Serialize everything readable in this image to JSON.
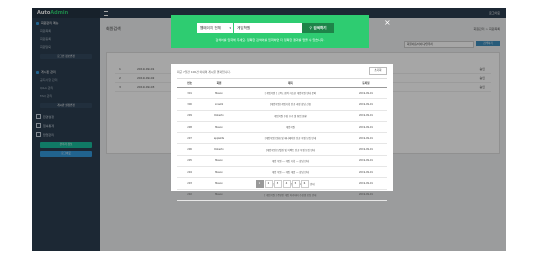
{
  "app": {
    "brand_main": "Auto",
    "brand_accent": "Admin",
    "logout": "로그아웃"
  },
  "sidebar": {
    "group1": {
      "title": "회원관리 메뉴",
      "items": [
        "회원목록",
        "회원등록",
        "회원탈퇴"
      ],
      "button": "로그인 정보변경"
    },
    "group2": {
      "title": "게시판 관리",
      "items": [
        "공지사항 관리",
        "Q&A 관리",
        "FAQ 관리"
      ],
      "button": "게시판 설정변경"
    },
    "links": [
      "환경설정",
      "접속통계",
      "팝업관리"
    ],
    "btn_green": "관리자 정보",
    "btn_blue": "로그아웃"
  },
  "page": {
    "title": "회원검색",
    "crumb": "회원관리 > 회원목록",
    "filter_select": "회원이름/아이디/연락처",
    "filter_button": "검색하기",
    "bg_rows": [
      {
        "no": "1",
        "date": "2019-09-01",
        "status": "승인"
      },
      {
        "no": "2",
        "date": "2019-09-02",
        "status": "승인"
      },
      {
        "no": "3",
        "date": "2019-09-03",
        "status": "승인"
      }
    ]
  },
  "search": {
    "select_value": "웹페이지 전체",
    "query": "게임학원",
    "button": "검색하기",
    "note": "검색어를 입력해 주세요. 정확한 검색어를 입력하면 더 정확한 결과를 얻을 수 있습니다.",
    "close": "×"
  },
  "results": {
    "info": "최근 7일간 100건 이내의 게시물 결과입니다.",
    "reset": "초기화",
    "columns": [
      "번호",
      "회원",
      "제목",
      "등록일"
    ],
    "rows": [
      [
        "301",
        "Mason",
        "[ 게임학원 ] 고3도 합격 가능한 게임학원 안내 문의",
        "2019-09-01"
      ],
      [
        "300",
        "ionwilk",
        "[게임학원] 게임기획 전공 과정 상담 신청",
        "2019-09-01"
      ],
      [
        "299",
        "Roberto",
        "게임학원 수강 후기 및 취업 현황",
        "2019-09-01"
      ],
      [
        "298",
        "Mason",
        "게임학원",
        "2019-09-01"
      ],
      [
        "297",
        "applelife",
        "[게임학원] 원화 및 애니메이션 전공 학생 모집 안내",
        "2019-09-01"
      ],
      [
        "296",
        "Roberto",
        "[게임학원] 모델링 및 이펙트 전공 학생 모집 안내",
        "2019-09-01"
      ],
      [
        "295",
        "Mason",
        "게임 학원 --- 게임 기획 --- 상담 안내",
        "2019-09-01"
      ],
      [
        "294",
        "Mason",
        "게임 학원 --- 게임 개발 --- 상담 안내",
        "2019-09-01"
      ],
      [
        "293",
        "Mason",
        "[게임학원] 게임 프로그래밍 전공 학생 모집 안내",
        "2019-09-01"
      ],
      [
        "292",
        "Mason",
        "[ 게임학원 ] 주말반 게임 아카데미 수강생 모집 안내",
        "2019-09-01"
      ]
    ],
    "pages": [
      "1",
      "2",
      "3",
      "4",
      "5",
      "6"
    ],
    "current_page": "1"
  }
}
